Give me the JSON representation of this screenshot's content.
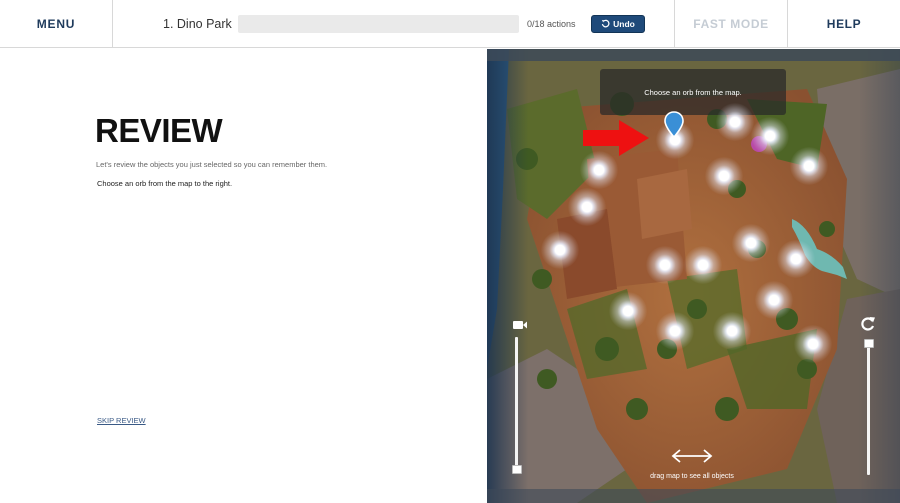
{
  "topbar": {
    "menu_label": "MENU",
    "level_title": "1. Dino Park",
    "progress_value": 0,
    "actions_text": "0/18 actions",
    "undo_label": "Undo",
    "fast_mode_label": "FAST MODE",
    "help_label": "HELP"
  },
  "review": {
    "title": "REVIEW",
    "subtitle": "Let's review the objects you just selected so you can remember them.",
    "instruction": "Choose an orb from the map to the right.",
    "skip_label": "SKIP REVIEW"
  },
  "map": {
    "banner_text": "Choose an orb from the map.",
    "drag_hint": "drag map to see all objects",
    "orb_count": 18,
    "zoom_slider_level": 0.0,
    "rotate_slider_level": 1.0,
    "icons": [
      "camera-icon",
      "rotate-icon",
      "location-pin-icon",
      "red-arrow-icon",
      "double-arrow-icon",
      "undo-icon"
    ]
  },
  "colors": {
    "brand_navy": "#1f3b5c",
    "undo_blue": "#1f4a7a",
    "fast_mode_disabled": "#c5ccd4",
    "pin_blue": "#3a8fd6",
    "arrow_red": "#ee1111"
  }
}
